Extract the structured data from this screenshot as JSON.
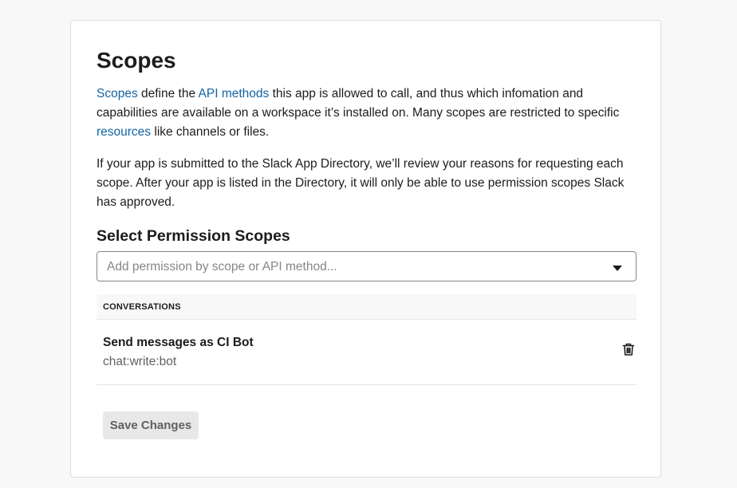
{
  "card": {
    "title": "Scopes",
    "intro": {
      "link1": "Scopes",
      "text1": " define the ",
      "link2": "API methods",
      "text2": " this app is allowed to call, and thus which infomation and capabilities are available on a workspace it’s installed on. Many scopes are restricted to specific ",
      "link3": "resources",
      "text3": " like channels or files."
    },
    "review_note": "If your app is submitted to the Slack App Directory, we’ll review your reasons for requesting each scope. After your app is listed in the Directory, it will only be able to use permission scopes Slack has approved.",
    "select_section": {
      "heading": "Select Permission Scopes",
      "placeholder": "Add permission by scope or API method..."
    },
    "groups": [
      {
        "label": "CONVERSATIONS",
        "scopes": [
          {
            "title": "Send messages as CI Bot",
            "scope": "chat:write:bot",
            "action_icon": "trash-icon"
          }
        ]
      }
    ],
    "save_label": "Save Changes"
  },
  "colors": {
    "link": "#1264a3",
    "text": "#1d1c1d",
    "muted": "#616061",
    "button_bg": "#e8e8e8",
    "page_bg": "#f8f8f8"
  }
}
